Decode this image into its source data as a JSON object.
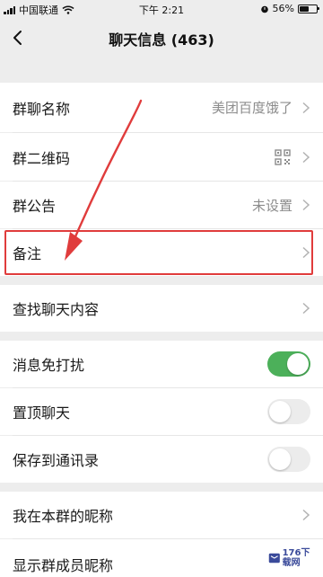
{
  "status_bar": {
    "carrier": "中国联通",
    "time": "下午 2:21",
    "battery_percent": "56%",
    "battery_level": 0.56
  },
  "nav": {
    "title": "聊天信息 (463)"
  },
  "rows": {
    "group_name": {
      "label": "群聊名称",
      "value": "美团百度饿了"
    },
    "qr_code": {
      "label": "群二维码"
    },
    "announcement": {
      "label": "群公告",
      "value": "未设置"
    },
    "remark": {
      "label": "备注"
    },
    "search_chat": {
      "label": "查找聊天内容"
    },
    "mute": {
      "label": "消息免打扰",
      "on": true
    },
    "pin": {
      "label": "置顶聊天",
      "on": false
    },
    "save_contacts": {
      "label": "保存到通讯录",
      "on": false
    },
    "my_nickname": {
      "label": "我在本群的昵称"
    },
    "show_nicknames": {
      "label": "显示群成员昵称"
    }
  },
  "annotation": {
    "color": "#e03c3c"
  },
  "watermark": {
    "text": "176下载网"
  },
  "colors": {
    "toggle_on": "#4cb05a",
    "background": "#ededed"
  }
}
